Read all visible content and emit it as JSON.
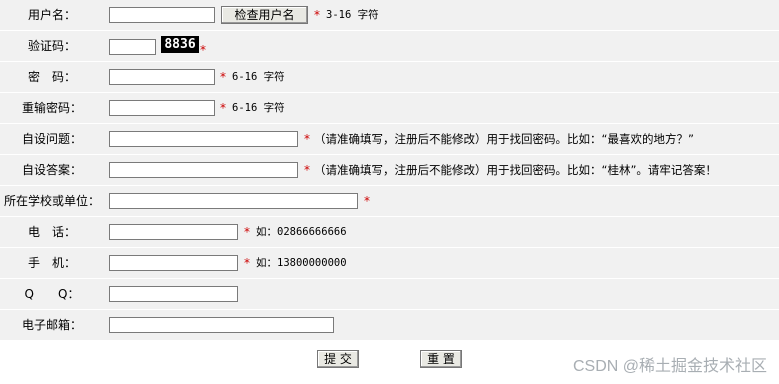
{
  "form": {
    "username": {
      "label": "用户名：",
      "value": "",
      "check_button": "检查用户名",
      "hint": "3-16 字符"
    },
    "captcha": {
      "label": "验证码：",
      "value": "",
      "code": "8836"
    },
    "password": {
      "label": "密　码：",
      "value": "",
      "hint": "6-16 字符"
    },
    "confirm_password": {
      "label": "重输密码：",
      "value": "",
      "hint": "6-16 字符"
    },
    "security_question": {
      "label": "自设问题：",
      "value": "",
      "hint": "（请准确填写，注册后不能修改）用于找回密码。比如：“最喜欢的地方？”"
    },
    "security_answer": {
      "label": "自设答案：",
      "value": "",
      "hint": "（请准确填写，注册后不能修改）用于找回密码。比如：“桂林”。请牢记答案！"
    },
    "school": {
      "label": "所在学校或单位：",
      "value": ""
    },
    "phone": {
      "label": "电　话：",
      "value": "",
      "hint": "如：02866666666"
    },
    "mobile": {
      "label": "手　机：",
      "value": "",
      "hint": "如：13800000000"
    },
    "qq": {
      "label": "Q　　Q：",
      "value": ""
    },
    "email": {
      "label": "电子邮箱：",
      "value": ""
    },
    "required_mark": "*",
    "submit_label": "提 交",
    "reset_label": "重 置"
  },
  "watermark": "CSDN @稀土掘金技术社区"
}
